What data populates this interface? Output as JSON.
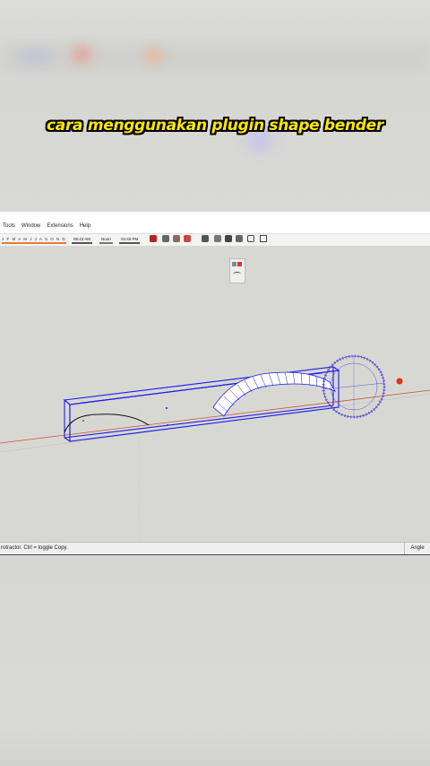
{
  "video": {
    "caption": "cara menggunakan plugin shape bender"
  },
  "menu": {
    "items": [
      "Tools",
      "Window",
      "Extensions",
      "Help"
    ]
  },
  "toolbar": {
    "months": "J F M A M J J A S O N D",
    "time_start": "06:43 AM",
    "noon": "Noon",
    "time_end": "04:45 PM",
    "icons": [
      "camera-icon",
      "outliner-icon",
      "materials-icon",
      "components-icon",
      "styles-icon",
      "scenes-icon",
      "home-icon",
      "warehouse-icon",
      "house-icon",
      "model-info-icon"
    ]
  },
  "statusbar": {
    "message": "rotractor.  Ctrl = toggle Copy.",
    "measure_label": "Angle"
  },
  "colors": {
    "selection": "#1c1cf0",
    "protractor": "#5a4cd6",
    "caption": "#ffe800"
  }
}
